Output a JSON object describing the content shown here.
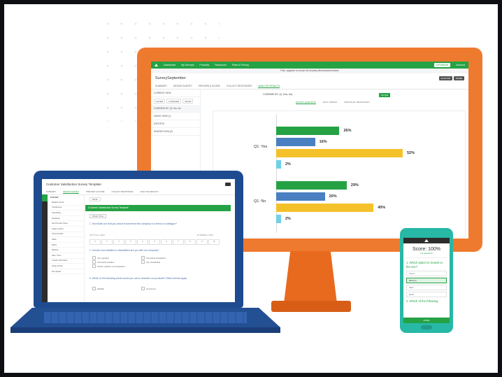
{
  "monitor": {
    "nav": {
      "items": [
        "Dashboard",
        "My Surveys",
        "Products",
        "Resources",
        "Plans & Pricing"
      ],
      "upgrade": "UPGRADE",
      "account": "Account"
    },
    "banner": "Plan: upgrade to unlock the Industry Benchmarks feature",
    "title": "SurveySeptember",
    "header_buttons": [
      "ANALYZE",
      "MORE"
    ],
    "tabs": [
      "SUMMARY",
      "DESIGN SURVEY",
      "PREVIEW & SCORE",
      "COLLECT RESPONSES",
      "ANALYZE RESULTS"
    ],
    "sidebar": {
      "current_view": "CURRENT VIEW",
      "filters": [
        "FILTER",
        "COMPARE",
        "SHOW"
      ],
      "saved": "COMPARE BY: Q1 Yes, No",
      "rows": [
        "SAVED VIEW (1)",
        "EXPORTS",
        "SHARED DATA (0)"
      ]
    },
    "question_title": "COMPARE BY: Q1 (Yes, No)",
    "filter_btn": "FILTER",
    "subtabs": [
      "DATA BY QUESTION",
      "DATA TRENDS",
      "INDIVIDUAL RESPONSES"
    ]
  },
  "chart_data": {
    "type": "bar",
    "orientation": "horizontal",
    "groups": [
      {
        "label": "Q1: Yes",
        "values": [
          {
            "v": 26,
            "label": "26%"
          },
          {
            "v": 16,
            "label": "16%"
          },
          {
            "v": 52,
            "label": "52%"
          },
          {
            "v": 2,
            "label": "2%"
          }
        ]
      },
      {
        "label": "Q1: No",
        "values": [
          {
            "v": 29,
            "label": "29%"
          },
          {
            "v": 20,
            "label": "20%"
          },
          {
            "v": 40,
            "label": "40%"
          },
          {
            "v": 2,
            "label": "2%"
          }
        ]
      }
    ],
    "colors": [
      "#25a244",
      "#4a7fc1",
      "#f5c12a",
      "#6fd0e6"
    ],
    "xlim": [
      0,
      100
    ]
  },
  "laptop": {
    "title": "Customer Satisfaction Survey Template",
    "tabs": [
      "SUMMARY",
      "DESIGN SURVEY",
      "PREVIEW & SCORE",
      "COLLECT RESPONSES",
      "ANALYZE RESULTS"
    ],
    "sidebar_header": "BUILDER",
    "sidebar_items": [
      "Multiple Choice",
      "Checkboxes",
      "Star Rating",
      "Dropdown",
      "Net Promoter Score",
      "Single Textbox",
      "Comment Box",
      "Slider",
      "Matrix",
      "Ranking",
      "Date / Time",
      "Contact Information",
      "Image Choice",
      "File Upload"
    ],
    "page_label": "PAGE",
    "page_title": "Customer Satisfaction Survey Template",
    "page_btn": "PAGE TITLE",
    "questions": [
      "1. How likely is it that you would recommend this company to a friend or colleague?",
      "2. Overall, how satisfied or dissatisfied are you with our company?",
      "3. Which of the following words would you use to describe our products? Select all that apply."
    ],
    "scale": [
      "0",
      "1",
      "2",
      "3",
      "4",
      "5",
      "6",
      "7",
      "8",
      "9",
      "10"
    ],
    "scale_left": "NOT AT ALL LIKELY",
    "scale_right": "EXTREMELY LIKELY",
    "q2_options": [
      "Very satisfied",
      "Somewhat satisfied",
      "Neither satisfied nor dissatisfied",
      "Somewhat dissatisfied",
      "Very dissatisfied"
    ],
    "q3_options": [
      "Reliable",
      "Overpriced"
    ]
  },
  "phone": {
    "score_title": "Score: 100%",
    "score_sub": "1/1 questions",
    "q1": "1. Which planet is closest to the sun?",
    "options": [
      "Venus",
      "Mercury",
      "Mars",
      "Earth"
    ],
    "selected": 1,
    "q2": "2. Which of the following",
    "footer": "DONE"
  }
}
